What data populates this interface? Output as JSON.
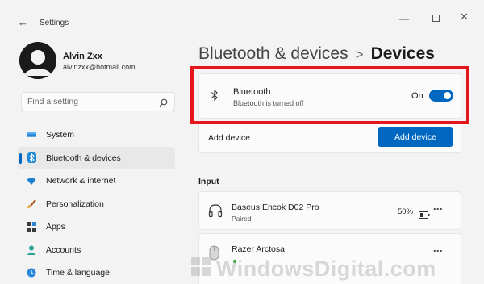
{
  "window": {
    "title": "Settings",
    "back_icon": "arrow-left-icon"
  },
  "user": {
    "name": "Alvin Zxx",
    "email": "alvinzxx@hotmail.com"
  },
  "search": {
    "placeholder": "Find a setting",
    "value": ""
  },
  "nav": {
    "items": [
      {
        "label": "System",
        "icon": "monitor-icon"
      },
      {
        "label": "Bluetooth & devices",
        "icon": "bluetooth-icon",
        "active": true
      },
      {
        "label": "Network & internet",
        "icon": "wifi-icon"
      },
      {
        "label": "Personalization",
        "icon": "brush-icon"
      },
      {
        "label": "Apps",
        "icon": "apps-icon"
      },
      {
        "label": "Accounts",
        "icon": "person-icon"
      },
      {
        "label": "Time & language",
        "icon": "globe-clock-icon"
      }
    ]
  },
  "breadcrumb": {
    "parent": "Bluetooth & devices",
    "separator": ">",
    "current": "Devices"
  },
  "bluetooth": {
    "title": "Bluetooth",
    "subtitle": "Bluetooth is turned off",
    "state_label": "On",
    "toggle_on": true
  },
  "add_device": {
    "label": "Add device",
    "button_label": "Add device"
  },
  "input_section": {
    "title": "Input",
    "devices": [
      {
        "name": "Baseus Encok D02 Pro",
        "status": "Paired",
        "battery": "50%",
        "icon": "headphones-icon"
      },
      {
        "name": "Razer Arctosa",
        "status": "",
        "icon": "mouse-icon"
      }
    ]
  },
  "watermark": "WindowsDigital.com",
  "colors": {
    "accent": "#0067c0",
    "highlight": "#e4161b",
    "background": "#f3f3f3"
  }
}
